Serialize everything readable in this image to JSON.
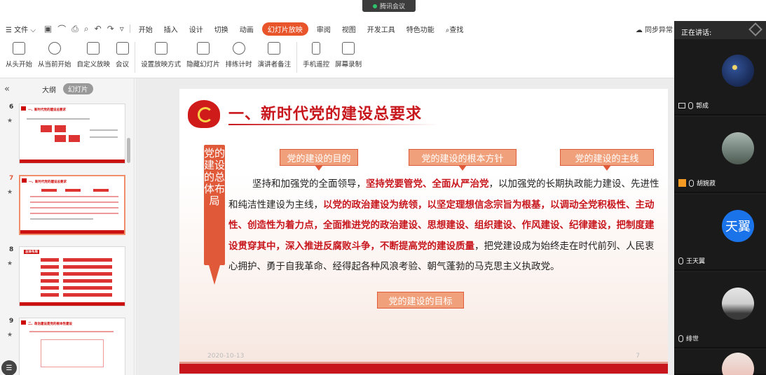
{
  "meeting": {
    "label": "腾讯会议"
  },
  "menubar": {
    "file": "文件",
    "tabs": [
      "开始",
      "插入",
      "设计",
      "切换",
      "动画",
      "幻灯片放映",
      "审阅",
      "视图",
      "开发工具",
      "特色功能"
    ],
    "active_tab": "幻灯片放映",
    "search": "查找",
    "sync": "同步异常"
  },
  "ribbon": {
    "buttons": [
      "从头开始",
      "从当前开始",
      "自定义放映",
      "会议",
      "设置放映方式",
      "隐藏幻灯片",
      "排练计时",
      "演讲者备注",
      "手机遥控",
      "屏幕录制"
    ]
  },
  "leftpanel": {
    "collapse": "«",
    "tab_outline": "大纲",
    "tab_slides": "幻灯片",
    "slides": [
      {
        "num": "6",
        "title": "一、新时代党的建设总要求"
      },
      {
        "num": "7",
        "title": "一、新时代党的建设总要求"
      },
      {
        "num": "8",
        "title": "总体布局"
      },
      {
        "num": "9",
        "title": "二、政治建设是党的根本性建设"
      }
    ],
    "star": "★",
    "help": "☰"
  },
  "slide": {
    "title": "一、新时代党的建设总要求",
    "banner": "党的建设的总体布局",
    "tags": {
      "purpose": "党的建设的目的",
      "policy": "党的建设的根本方针",
      "mainline": "党的建设的主线",
      "goal": "党的建设的目标"
    },
    "body": {
      "p1": "坚持和加强党的全面领导，",
      "h1": "坚持党要管党、全面从严治党",
      "p2": "，以加强党的长期执政能力建设、先进性和纯洁性建设为主线，",
      "h2": "以党的政治建设为统领，以坚定理想信念宗旨为根基，以调动全党积极性、主动性、创造性为着力点，全面推进党的政治建设、思想建设、组织建设、作风建设、纪律建设，把制度建设贯穿其中，深入推进反腐败斗争，不断提高党的建设质量",
      "p3": "，把党建设成为始终走在时代前列、人民衷心拥护、勇于自我革命、经得起各种风浪考验、朝气蓬勃的马克思主义执政党。"
    },
    "date": "2020-10-13",
    "page": "7"
  },
  "rightpanel": {
    "speaking": "正在讲话:",
    "participants": [
      {
        "name": "郭成"
      },
      {
        "name": "胡婉菽"
      },
      {
        "name": "王天翼",
        "initials": "天翼"
      },
      {
        "name": "绯世"
      },
      {
        "name": ""
      }
    ]
  }
}
